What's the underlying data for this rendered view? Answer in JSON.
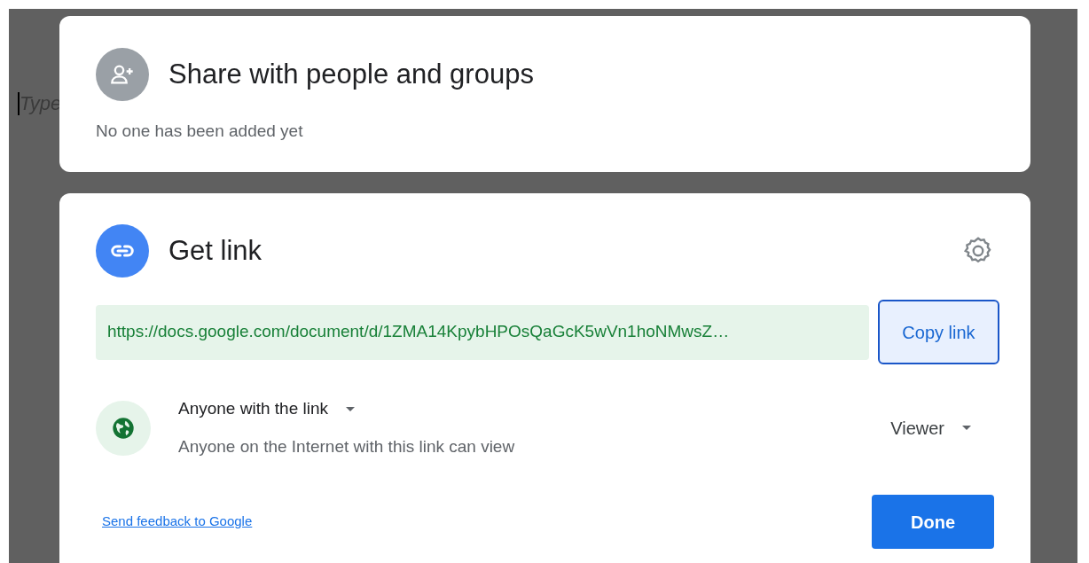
{
  "background_document": {
    "placeholder": "Type"
  },
  "share_card": {
    "title": "Share with people and groups",
    "status": "No one has been added yet"
  },
  "link_card": {
    "title": "Get link",
    "url": "https://docs.google.com/document/d/1ZMA14KpybHPOsQaGcK5wVn1hoNMwsZ…",
    "copy_button": "Copy link",
    "access": {
      "scope": "Anyone with the link",
      "description": "Anyone on the Internet with this link can view",
      "role": "Viewer"
    },
    "feedback_link": "Send feedback to Google",
    "done_button": "Done"
  }
}
